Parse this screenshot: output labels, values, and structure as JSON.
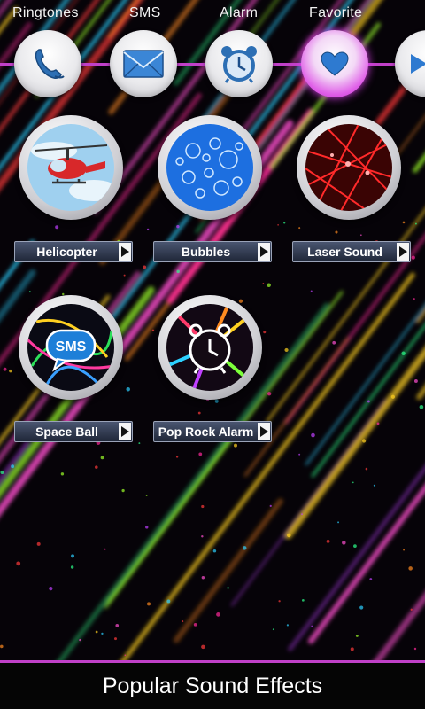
{
  "tabs": [
    {
      "label": "Ringtones",
      "icon": "phone-icon"
    },
    {
      "label": "SMS",
      "icon": "envelope-icon"
    },
    {
      "label": "Alarm",
      "icon": "alarm-clock-icon"
    },
    {
      "label": "Favorite",
      "icon": "heart-icon",
      "active": true
    },
    {
      "label": "",
      "icon": "chevron-right-icon"
    }
  ],
  "sounds": [
    {
      "label": "Helicopter",
      "icon": "helicopter-icon"
    },
    {
      "label": "Bubbles",
      "icon": "bubbles-icon"
    },
    {
      "label": "Laser Sound",
      "icon": "laser-icon"
    },
    {
      "label": "Space Ball",
      "icon": "sms-bubble-icon"
    },
    {
      "label": "Pop Rock Alarm",
      "icon": "alarm-clock-icon"
    }
  ],
  "footer": {
    "title": "Popular Sound Effects"
  },
  "colors": {
    "accent": "#c040c8",
    "label_bar": "#2a3347"
  }
}
